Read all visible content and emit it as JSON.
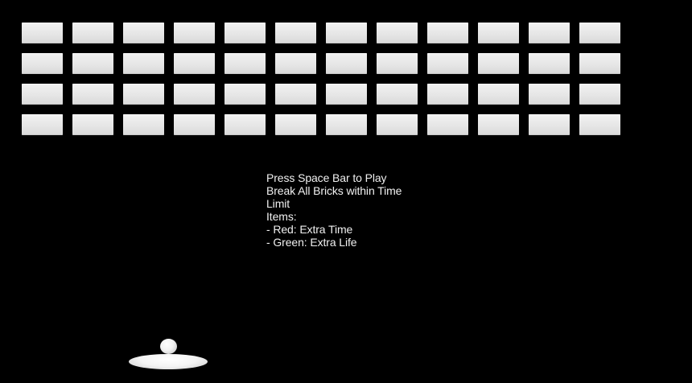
{
  "game": {
    "background_color": "#000000",
    "brick_color": "#e6e6e6",
    "text_color": "#f0f0f0"
  },
  "bricks": {
    "rows": 4,
    "columns": 12
  },
  "instructions": {
    "line1": "Press Space Bar to Play",
    "line2": "Break All Bricks within Time",
    "line3": "Limit",
    "line4": "Items:",
    "line5": "- Red: Extra Time",
    "line6": "- Green: Extra Life"
  }
}
